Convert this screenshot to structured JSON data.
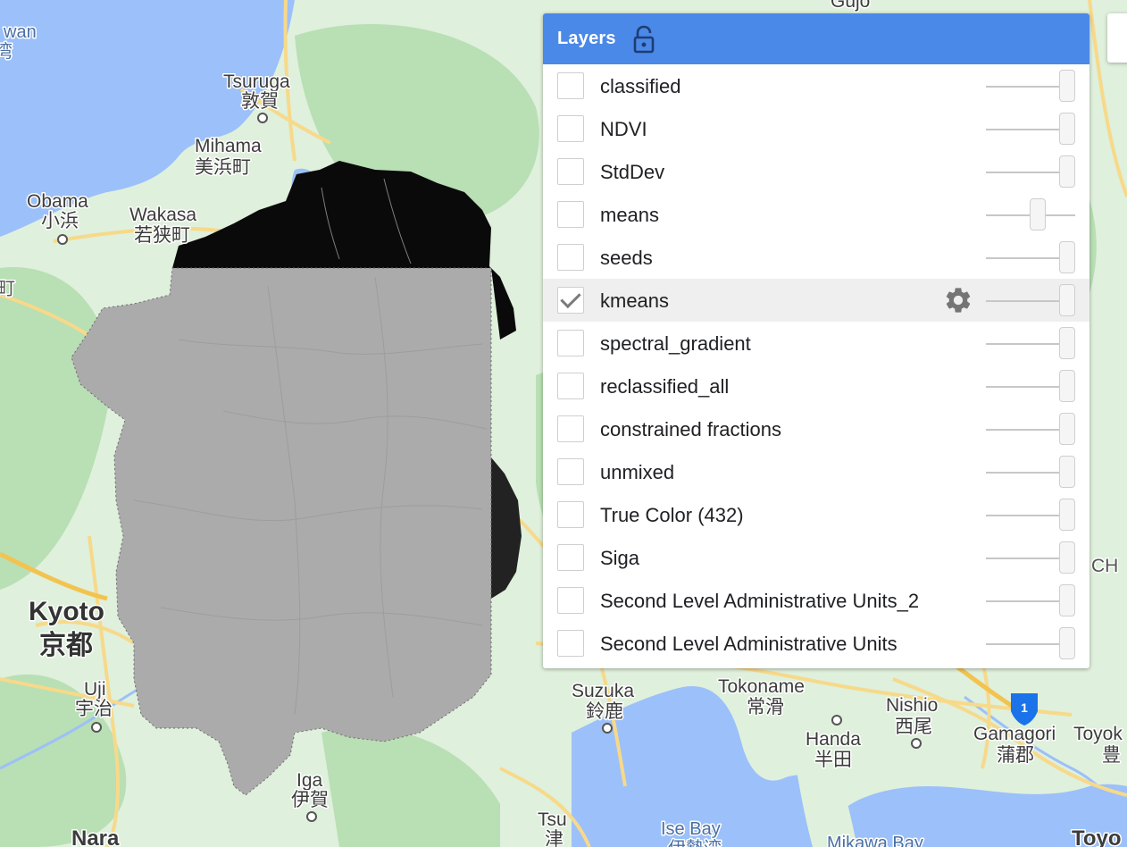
{
  "map": {
    "place_labels": [
      {
        "name": "Tsuruga",
        "native": "敦賀"
      },
      {
        "name": "Mihama",
        "native": "美浜町"
      },
      {
        "name": "Obama",
        "native": "小浜"
      },
      {
        "name": "Wakasa",
        "native": "若狭町"
      },
      {
        "name": "Kyoto",
        "native": "京都"
      },
      {
        "name": "Uji",
        "native": "宇治"
      },
      {
        "name": "Iga",
        "native": "伊賀"
      },
      {
        "name": "Nara",
        "native": ""
      },
      {
        "name": "Tsu",
        "native": "津"
      },
      {
        "name": "Suzuka",
        "native": "鈴鹿"
      },
      {
        "name": "Tokoname",
        "native": "常滑"
      },
      {
        "name": "Handa",
        "native": "半田"
      },
      {
        "name": "Nishio",
        "native": "西尾"
      },
      {
        "name": "Gamagori",
        "native": "蒲郡"
      },
      {
        "name": "Toyok",
        "native": "豊"
      },
      {
        "name": "Toyo",
        "native": ""
      },
      {
        "name": "Gujo",
        "native": ""
      }
    ],
    "water_labels": [
      "Ise Bay",
      "伊勢湾",
      "Mikawa Bay"
    ],
    "edge_labels": [
      "wan",
      "湾",
      "町",
      "CH"
    ],
    "route_shield": "1",
    "colors": {
      "land": "#dff0dc",
      "forest": "#b9dfb4",
      "water": "#9cc0f9",
      "overlay_gray": "#ababab",
      "overlay_black": "#0a0a0a",
      "road": "#f7d98a"
    }
  },
  "layers_panel": {
    "title": "Layers",
    "lock_icon": "lock-open-icon",
    "header_color": "#4a89e8",
    "layers": [
      {
        "name": "classified",
        "checked": false,
        "opacity": 1.0,
        "active": false
      },
      {
        "name": "NDVI",
        "checked": false,
        "opacity": 1.0,
        "active": false
      },
      {
        "name": "StdDev",
        "checked": false,
        "opacity": 1.0,
        "active": false
      },
      {
        "name": "means",
        "checked": false,
        "opacity": 0.6,
        "active": false
      },
      {
        "name": "seeds",
        "checked": false,
        "opacity": 1.0,
        "active": false
      },
      {
        "name": "kmeans",
        "checked": true,
        "opacity": 1.0,
        "active": true,
        "settings_icon": "gear-icon"
      },
      {
        "name": "spectral_gradient",
        "checked": false,
        "opacity": 1.0,
        "active": false
      },
      {
        "name": "reclassified_all",
        "checked": false,
        "opacity": 1.0,
        "active": false
      },
      {
        "name": "constrained fractions",
        "checked": false,
        "opacity": 1.0,
        "active": false
      },
      {
        "name": "unmixed",
        "checked": false,
        "opacity": 1.0,
        "active": false
      },
      {
        "name": "True Color (432)",
        "checked": false,
        "opacity": 1.0,
        "active": false
      },
      {
        "name": "Siga",
        "checked": false,
        "opacity": 1.0,
        "active": false
      },
      {
        "name": "Second Level Administrative Units_2",
        "checked": false,
        "opacity": 1.0,
        "active": false
      },
      {
        "name": "Second Level Administrative Units",
        "checked": false,
        "opacity": 1.0,
        "active": false
      }
    ]
  }
}
